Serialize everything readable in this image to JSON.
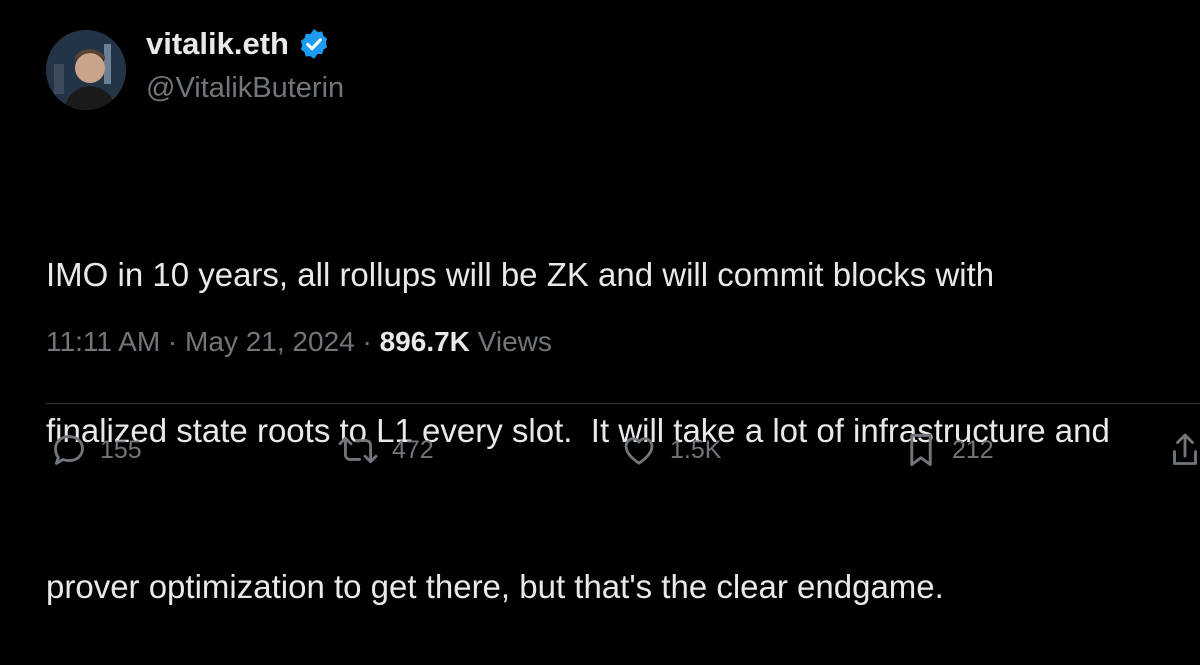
{
  "author": {
    "display_name": "vitalik.eth",
    "handle": "@VitalikButerin",
    "verified_color": "#1d9bf0"
  },
  "tweet": {
    "lines": [
      "IMO in 10 years, all rollups will be ZK and will commit blocks with",
      "finalized state roots to L1 every slot.  It will take a lot of infrastructure and",
      "prover optimization to get there, but that's the clear endgame."
    ]
  },
  "meta": {
    "time": "11:11 AM",
    "separator": " · ",
    "date": "May 21, 2024",
    "views_count": "896.7K",
    "views_label": " Views"
  },
  "actions": {
    "replies": "155",
    "reposts": "472",
    "likes": "1.5K",
    "bookmarks": "212"
  },
  "icons": {
    "verified": "verified-badge-icon",
    "reply": "reply-icon",
    "repost": "repost-icon",
    "like": "heart-icon",
    "bookmark": "bookmark-icon",
    "share": "share-icon"
  },
  "colors": {
    "background": "#000000",
    "text": "#e7e9ea",
    "secondary": "#71767b",
    "divider": "#2f3336"
  }
}
